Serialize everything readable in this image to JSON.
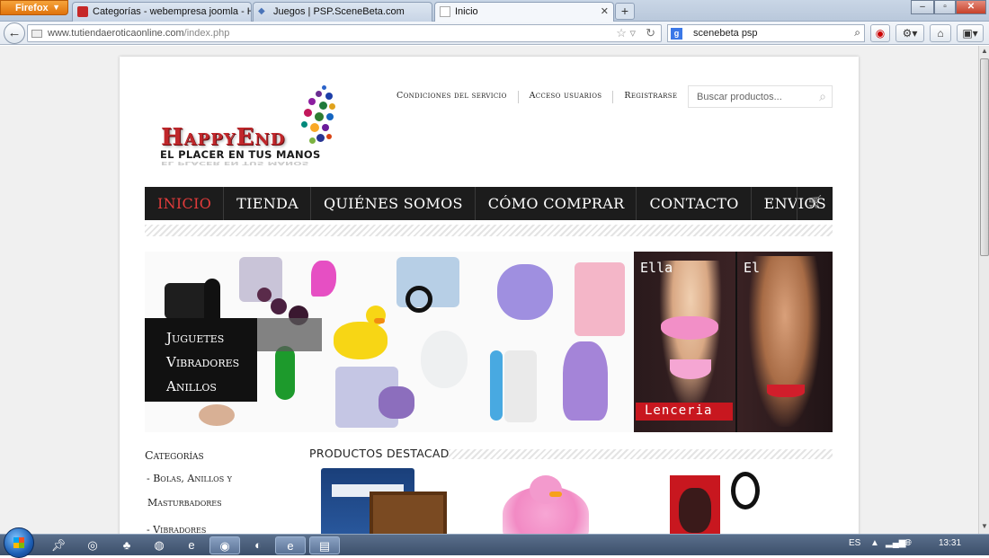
{
  "browser": {
    "menu_label": "Firefox",
    "tabs": [
      {
        "title": "Categorías - webempresa joomla - Hosti..."
      },
      {
        "title": "Juegos | PSP.SceneBeta.com"
      },
      {
        "title": "Inicio"
      }
    ],
    "url_host": "www.tutiendaeroticaonline.com",
    "url_path": "/index.php",
    "search_value": "scenebeta psp"
  },
  "site": {
    "logo_title": "HappyEnd",
    "logo_subtitle": "El placer en tus manos",
    "top_links": [
      "Condiciones del servicio",
      "Acceso usuarios",
      "Registrarse"
    ],
    "search_placeholder": "Buscar productos...",
    "main_nav": [
      "INICIO",
      "TIENDA",
      "QUIÉNES SOMOS",
      "CÓMO COMPRAR",
      "CONTACTO",
      "ENVIOS"
    ],
    "banner_categories": [
      "Juguetes",
      "Vibradores",
      "Anillos"
    ],
    "banner_ella": "Ella",
    "banner_el": "El",
    "banner_lenceria": "Lenceria",
    "sidebar_title": "Categorías",
    "sidebar_items": [
      "- Bolas, Anillos y",
      "Masturbadores",
      "- Vibradores"
    ],
    "featured_title": "PRODUCTOS DESTACADOS"
  },
  "taskbar": {
    "language": "ES",
    "time": "13:31"
  },
  "colors": {
    "nav_active": "#e23b3b",
    "nav_bg": "#1c1c1c",
    "lenceria_label": "#c8171f",
    "logo_red": "#c0262a"
  }
}
